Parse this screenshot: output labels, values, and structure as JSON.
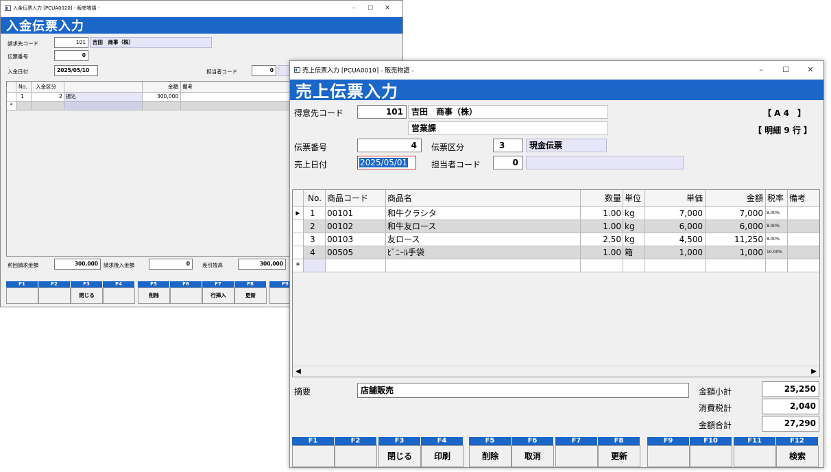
{
  "back_window": {
    "title": "入金伝票入力 [PCUA0020] - 販売物語 -",
    "banner": "入金伝票入力",
    "billing_code_label": "請求先コード",
    "billing_code_value": "101",
    "billing_name": "吉田　商事（株）",
    "slip_no_label": "伝票番号",
    "slip_no_value": "0",
    "date_label": "入金日付",
    "date_value": "2025/05/10",
    "staff_label": "担当者コード",
    "staff_value": "0",
    "grid_headers": [
      "No.",
      "入金区分",
      "",
      "金額",
      "備考"
    ],
    "grid_rows": [
      {
        "no": "1",
        "kubun": "2",
        "kubun_name": "振込",
        "amount": "300,000",
        "note": ""
      }
    ],
    "new_row_marker": "*",
    "prev_bill_label": "前回請求金額",
    "prev_bill_value": "300,000",
    "after_payment_label": "請求後入金額",
    "after_payment_value": "0",
    "balance_label": "差引残高",
    "balance_value": "300,000",
    "fkeys": [
      "F1",
      "F2",
      "F3",
      "F4",
      "F5",
      "F6",
      "F7",
      "F8",
      "F9"
    ],
    "fbuttons": [
      "",
      "",
      "閉じる",
      "",
      "削除",
      "",
      "行挿入",
      "更新",
      ""
    ]
  },
  "front_window": {
    "title": "売上伝票入力 [PCUA0010] - 販売物語 -",
    "banner": "売上伝票入力",
    "customer_code_label": "得意先コード",
    "customer_code_value": "101",
    "customer_name": "吉田　商事（株）",
    "department": "営業課",
    "paper_size": "【 A 4　】",
    "detail_lines": "【 明細 9 行 】",
    "slip_no_label": "伝票番号",
    "slip_no_value": "4",
    "slip_type_label": "伝票区分",
    "slip_type_code": "3",
    "slip_type_name": "現金伝票",
    "sales_date_label": "売上日付",
    "sales_date_value": "2025/05/01",
    "staff_label": "担当者コード",
    "staff_value": "0",
    "staff_name": "",
    "grid_headers": [
      "No.",
      "商品コード",
      "商品名",
      "数量",
      "単位",
      "単価",
      "金額",
      "税率",
      "備考"
    ],
    "grid_rows": [
      {
        "no": "1",
        "code": "00101",
        "name": "和牛クラシタ",
        "qty": "1.00",
        "unit": "kg",
        "price": "7,000",
        "amount": "7,000",
        "tax": "8.00%",
        "note": ""
      },
      {
        "no": "2",
        "code": "00102",
        "name": "和牛友ロース",
        "qty": "1.00",
        "unit": "kg",
        "price": "6,000",
        "amount": "6,000",
        "tax": "8.00%",
        "note": ""
      },
      {
        "no": "3",
        "code": "00103",
        "name": "友ロース",
        "qty": "2.50",
        "unit": "kg",
        "price": "4,500",
        "amount": "11,250",
        "tax": "8.00%",
        "note": ""
      },
      {
        "no": "4",
        "code": "00505",
        "name": "ﾋﾞﾆｰﾙ手袋",
        "qty": "1.00",
        "unit": "箱",
        "price": "1,000",
        "amount": "1,000",
        "tax": "10.00%",
        "note": ""
      }
    ],
    "new_row_marker": "*",
    "current_row_marker": "▶",
    "memo_label": "摘要",
    "memo_value": "店舗販売",
    "subtotal_label": "金額小計",
    "subtotal_value": "25,250",
    "tax_label": "消費税計",
    "tax_value": "2,040",
    "total_label": "金額合計",
    "total_value": "27,290",
    "fkeys": [
      "F1",
      "F2",
      "F3",
      "F4",
      "F5",
      "F6",
      "F7",
      "F8",
      "F9",
      "F10",
      "F11",
      "F12"
    ],
    "fbuttons": [
      "",
      "",
      "閉じる",
      "印刷",
      "削除",
      "取消",
      "",
      "更新",
      "",
      "",
      "",
      "検索"
    ]
  },
  "window_controls": {
    "minimize": "–",
    "maximize": "☐",
    "close": "✕"
  },
  "colors": {
    "banner": "#1a66c9",
    "row_alt": "#d9d9d9",
    "lavender": "#e6e6f8",
    "date_border": "#d03030"
  }
}
